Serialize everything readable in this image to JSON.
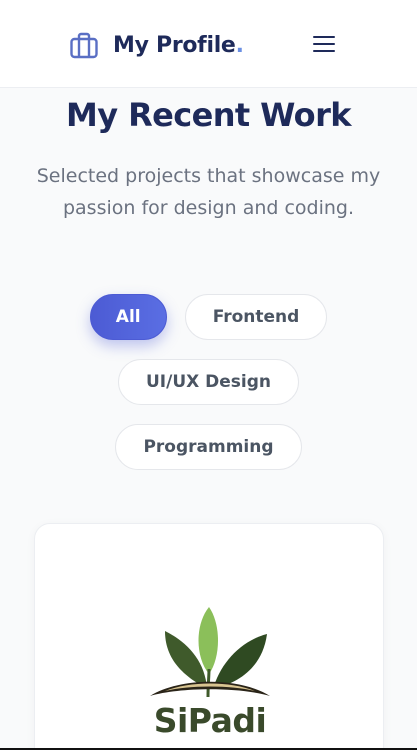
{
  "header": {
    "brand": "My Profile",
    "brand_dot": ".",
    "brand_icon": "briefcase-icon",
    "menu_icon": "hamburger-menu-icon",
    "accent_color": "#6b8fe3"
  },
  "section": {
    "title": "My Recent Work",
    "subtitle": "Selected projects that showcase my passion for design and coding."
  },
  "filters": {
    "items": [
      {
        "label": "All",
        "active": true
      },
      {
        "label": "Frontend",
        "active": false
      },
      {
        "label": "UI/UX Design",
        "active": false
      },
      {
        "label": "Programming",
        "active": false
      }
    ],
    "active_color": "#4c5bd4"
  },
  "project": {
    "logo_text": "SiPadi",
    "logo_icon": "sprout-leaves-icon"
  }
}
